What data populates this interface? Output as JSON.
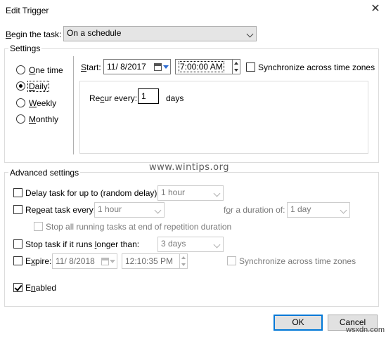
{
  "window": {
    "title": "Edit Trigger",
    "close_glyph": "✕"
  },
  "begin": {
    "label": "Begin the task:",
    "value": "On a schedule"
  },
  "settings": {
    "legend": "Settings",
    "radios": [
      {
        "label": "One time",
        "checked": false
      },
      {
        "label": "Daily",
        "checked": true
      },
      {
        "label": "Weekly",
        "checked": false
      },
      {
        "label": "Monthly",
        "checked": false
      }
    ],
    "start_label": "Start:",
    "start_date": "11/ 8/2017",
    "start_time": "7:00:00 AM",
    "sync_label": "Synchronize across time zones",
    "recur_label": "Recur every:",
    "recur_value": "1",
    "recur_unit": "days"
  },
  "advanced": {
    "legend": "Advanced settings",
    "delay": {
      "label": "Delay task for up to (random delay):",
      "value": "1 hour",
      "checked": false
    },
    "repeat": {
      "label": "Repeat task every:",
      "value": "1 hour",
      "checked": false,
      "duration_label": "for a duration of:",
      "duration_value": "1 day"
    },
    "stop_running": {
      "label": "Stop all running tasks at end of repetition duration",
      "checked": false
    },
    "stop_longer": {
      "label": "Stop task if it runs longer than:",
      "value": "3 days",
      "checked": false
    },
    "expire": {
      "label": "Expire:",
      "date": "11/ 8/2018",
      "time": "12:10:35 PM",
      "checked": false,
      "sync_label": "Synchronize across time zones"
    },
    "enabled": {
      "label": "Enabled",
      "checked": true
    }
  },
  "buttons": {
    "ok": "OK",
    "cancel": "Cancel"
  },
  "watermark": "www.wintips.org",
  "corner_mark": "wsxdn.com"
}
